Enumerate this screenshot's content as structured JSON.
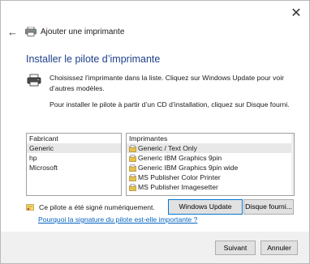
{
  "window": {
    "title": "Ajouter une imprimante",
    "close_glyph": "✕",
    "back_glyph": "←"
  },
  "page": {
    "heading": "Installer le pilote d’imprimante",
    "intro_line": "Choisissez l’imprimante dans la liste. Cliquez sur Windows Update pour voir d’autres modèles.",
    "intro_disk": "Pour installer le pilote à partir d’un CD d’installation, cliquez sur Disque fourni."
  },
  "manufacturers": {
    "header": "Fabricant",
    "items": [
      "Generic",
      "hp",
      "Microsoft"
    ],
    "selected_index": 0
  },
  "printers": {
    "header": "Imprimantes",
    "items": [
      "Generic / Text Only",
      "Generic IBM Graphics 9pin",
      "Generic IBM Graphics 9pin wide",
      "MS Publisher Color Printer",
      "MS Publisher Imagesetter"
    ],
    "selected_index": 0
  },
  "signature": {
    "text": "Ce pilote a été signé numériquement.",
    "link": "Pourquoi la signature du pilote est-elle importante ?"
  },
  "buttons": {
    "windows_update": "Windows Update",
    "have_disk": "Disque fourni...",
    "next": "Suivant",
    "cancel": "Annuler"
  },
  "colors": {
    "heading": "#1e3f8a",
    "link": "#0563c1",
    "focus_border": "#0078d7"
  },
  "icons": {
    "title": "printer-icon",
    "intro": "printer-icon",
    "driver": "driver-icon",
    "signed": "certificate-icon"
  }
}
